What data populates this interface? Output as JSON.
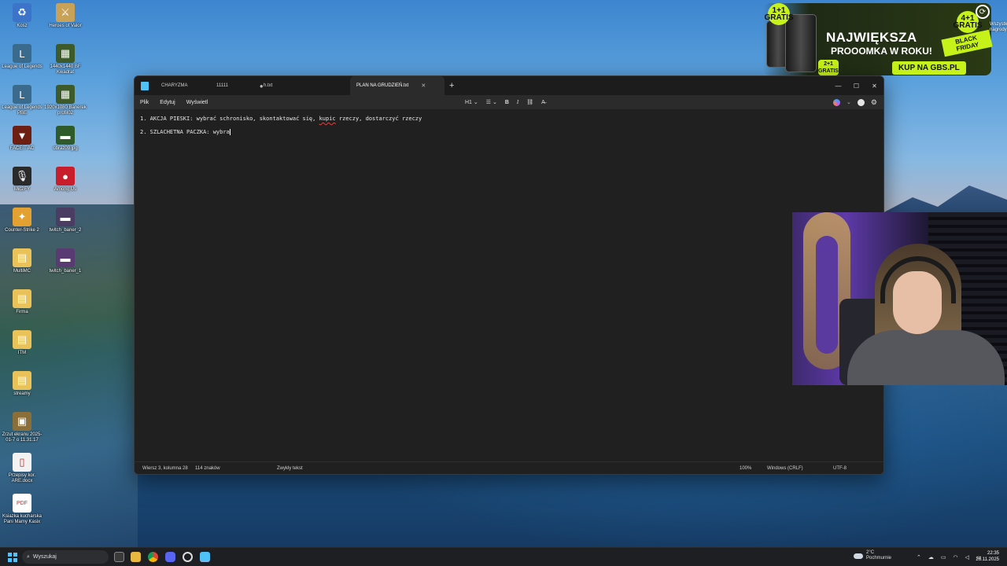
{
  "desktop": {
    "icons": [
      {
        "label": "Kosz",
        "glyph": "♻",
        "color": "#3b74c9"
      },
      {
        "label": "Heroes of Valor",
        "glyph": "⚔",
        "color": "#c9a25a"
      },
      {
        "label": "League of Legends",
        "glyph": "L",
        "color": "#3a6b8c"
      },
      {
        "label": "1440x1440 BF Kwadrat",
        "glyph": "▦",
        "color": "#3d5a2a"
      },
      {
        "label": "League of Legends PBE",
        "glyph": "L",
        "color": "#3a6b8c"
      },
      {
        "label": "1920x1080 Banerek profiI02",
        "glyph": "▦",
        "color": "#3d5a2a"
      },
      {
        "label": "FACEIT AC",
        "glyph": "▼",
        "color": "#6d1f12"
      },
      {
        "label": "obraz09.jpg",
        "glyph": "▬",
        "color": "#2f5a2a"
      },
      {
        "label": "Mic2FY",
        "glyph": "🎙",
        "color": "#2a2a2a"
      },
      {
        "label": "Among Us",
        "glyph": "●",
        "color": "#c81d2a"
      },
      {
        "label": "Counter-Strike 2",
        "glyph": "✦",
        "color": "#e3a132"
      },
      {
        "label": "twitch_baner_2",
        "glyph": "▬",
        "color": "#4b3c63"
      },
      {
        "label": "MultiMC",
        "glyph": "▤",
        "color": "#e9c35a"
      },
      {
        "label": "twitch_baner_1",
        "glyph": "▬",
        "color": "#5a3a72"
      },
      {
        "label": "Firma",
        "glyph": "▤",
        "color": "#e9c35a"
      },
      {
        "label": "ITM",
        "glyph": "▤",
        "color": "#e9c35a"
      },
      {
        "label": "streamy",
        "glyph": "▤",
        "color": "#e9c35a"
      },
      {
        "label": "Zrzut ekranu 2025-01-7 o 11.31.17",
        "glyph": "▣",
        "color": "#8b6f3a"
      },
      {
        "label": "Przepisy kor. ARE.docx",
        "glyph": "▯",
        "color": "#f2f2f2"
      },
      {
        "label": "Ksiazka kucharska Pani Mamy Kasix",
        "glyph": "PDF",
        "color": "#ffffff"
      }
    ]
  },
  "ad": {
    "headline": "NAJWIĘKSZA",
    "subline": "PROOOMKA W ROKU!",
    "badge_left": "1+1 GRATIS",
    "badge_mid": "2+1 GRATIS",
    "badge_right": "4+1 GRATIS",
    "black_friday": "BLACK FRIDAY",
    "cta": "KUP NA GBS.PL",
    "corner_text": "Wszystkie nagrody",
    "accent": "#c6f21a"
  },
  "notepad": {
    "tabs": [
      {
        "label": "CHARYZMA",
        "active": false
      },
      {
        "label": "11111",
        "active": false,
        "modified": "●"
      },
      {
        "label": "h.txt",
        "active": false
      },
      {
        "label": "PLAN NA GRUDZIEŃ.txt",
        "active": true,
        "close": "✕"
      }
    ],
    "new_tab": "+",
    "window_controls": {
      "minimize": "—",
      "maximize": "☐",
      "close": "✕"
    },
    "menu": [
      "Plik",
      "Edytuj",
      "Wyświetl"
    ],
    "format": {
      "heading": "H1",
      "list": "☰",
      "bold": "B",
      "italic": "I",
      "link": "⛓",
      "clear": "A̶"
    },
    "lines": [
      {
        "before": "1. AKCJA PIESKI: wybrać schronisko, skontaktować się, ",
        "misspelled": "kupic",
        "after": " rzeczy, dostarczyć rzeczy"
      },
      {
        "before": "2. SZLACHETNA PACZKA: wybra",
        "misspelled": "",
        "after": ""
      }
    ],
    "status": {
      "position": "Wiersz 3, kolumna 28",
      "chars": "114 znaków",
      "format": "Zwykły tekst",
      "zoom": "100%",
      "line_ending": "Windows (CRLF)",
      "encoding": "UTF-8"
    }
  },
  "taskbar": {
    "search_placeholder": "Wyszukaj",
    "weather_temp": "2°C",
    "weather_desc": "Pochmurnie",
    "time": "22:35",
    "date": "26.11.2025"
  }
}
